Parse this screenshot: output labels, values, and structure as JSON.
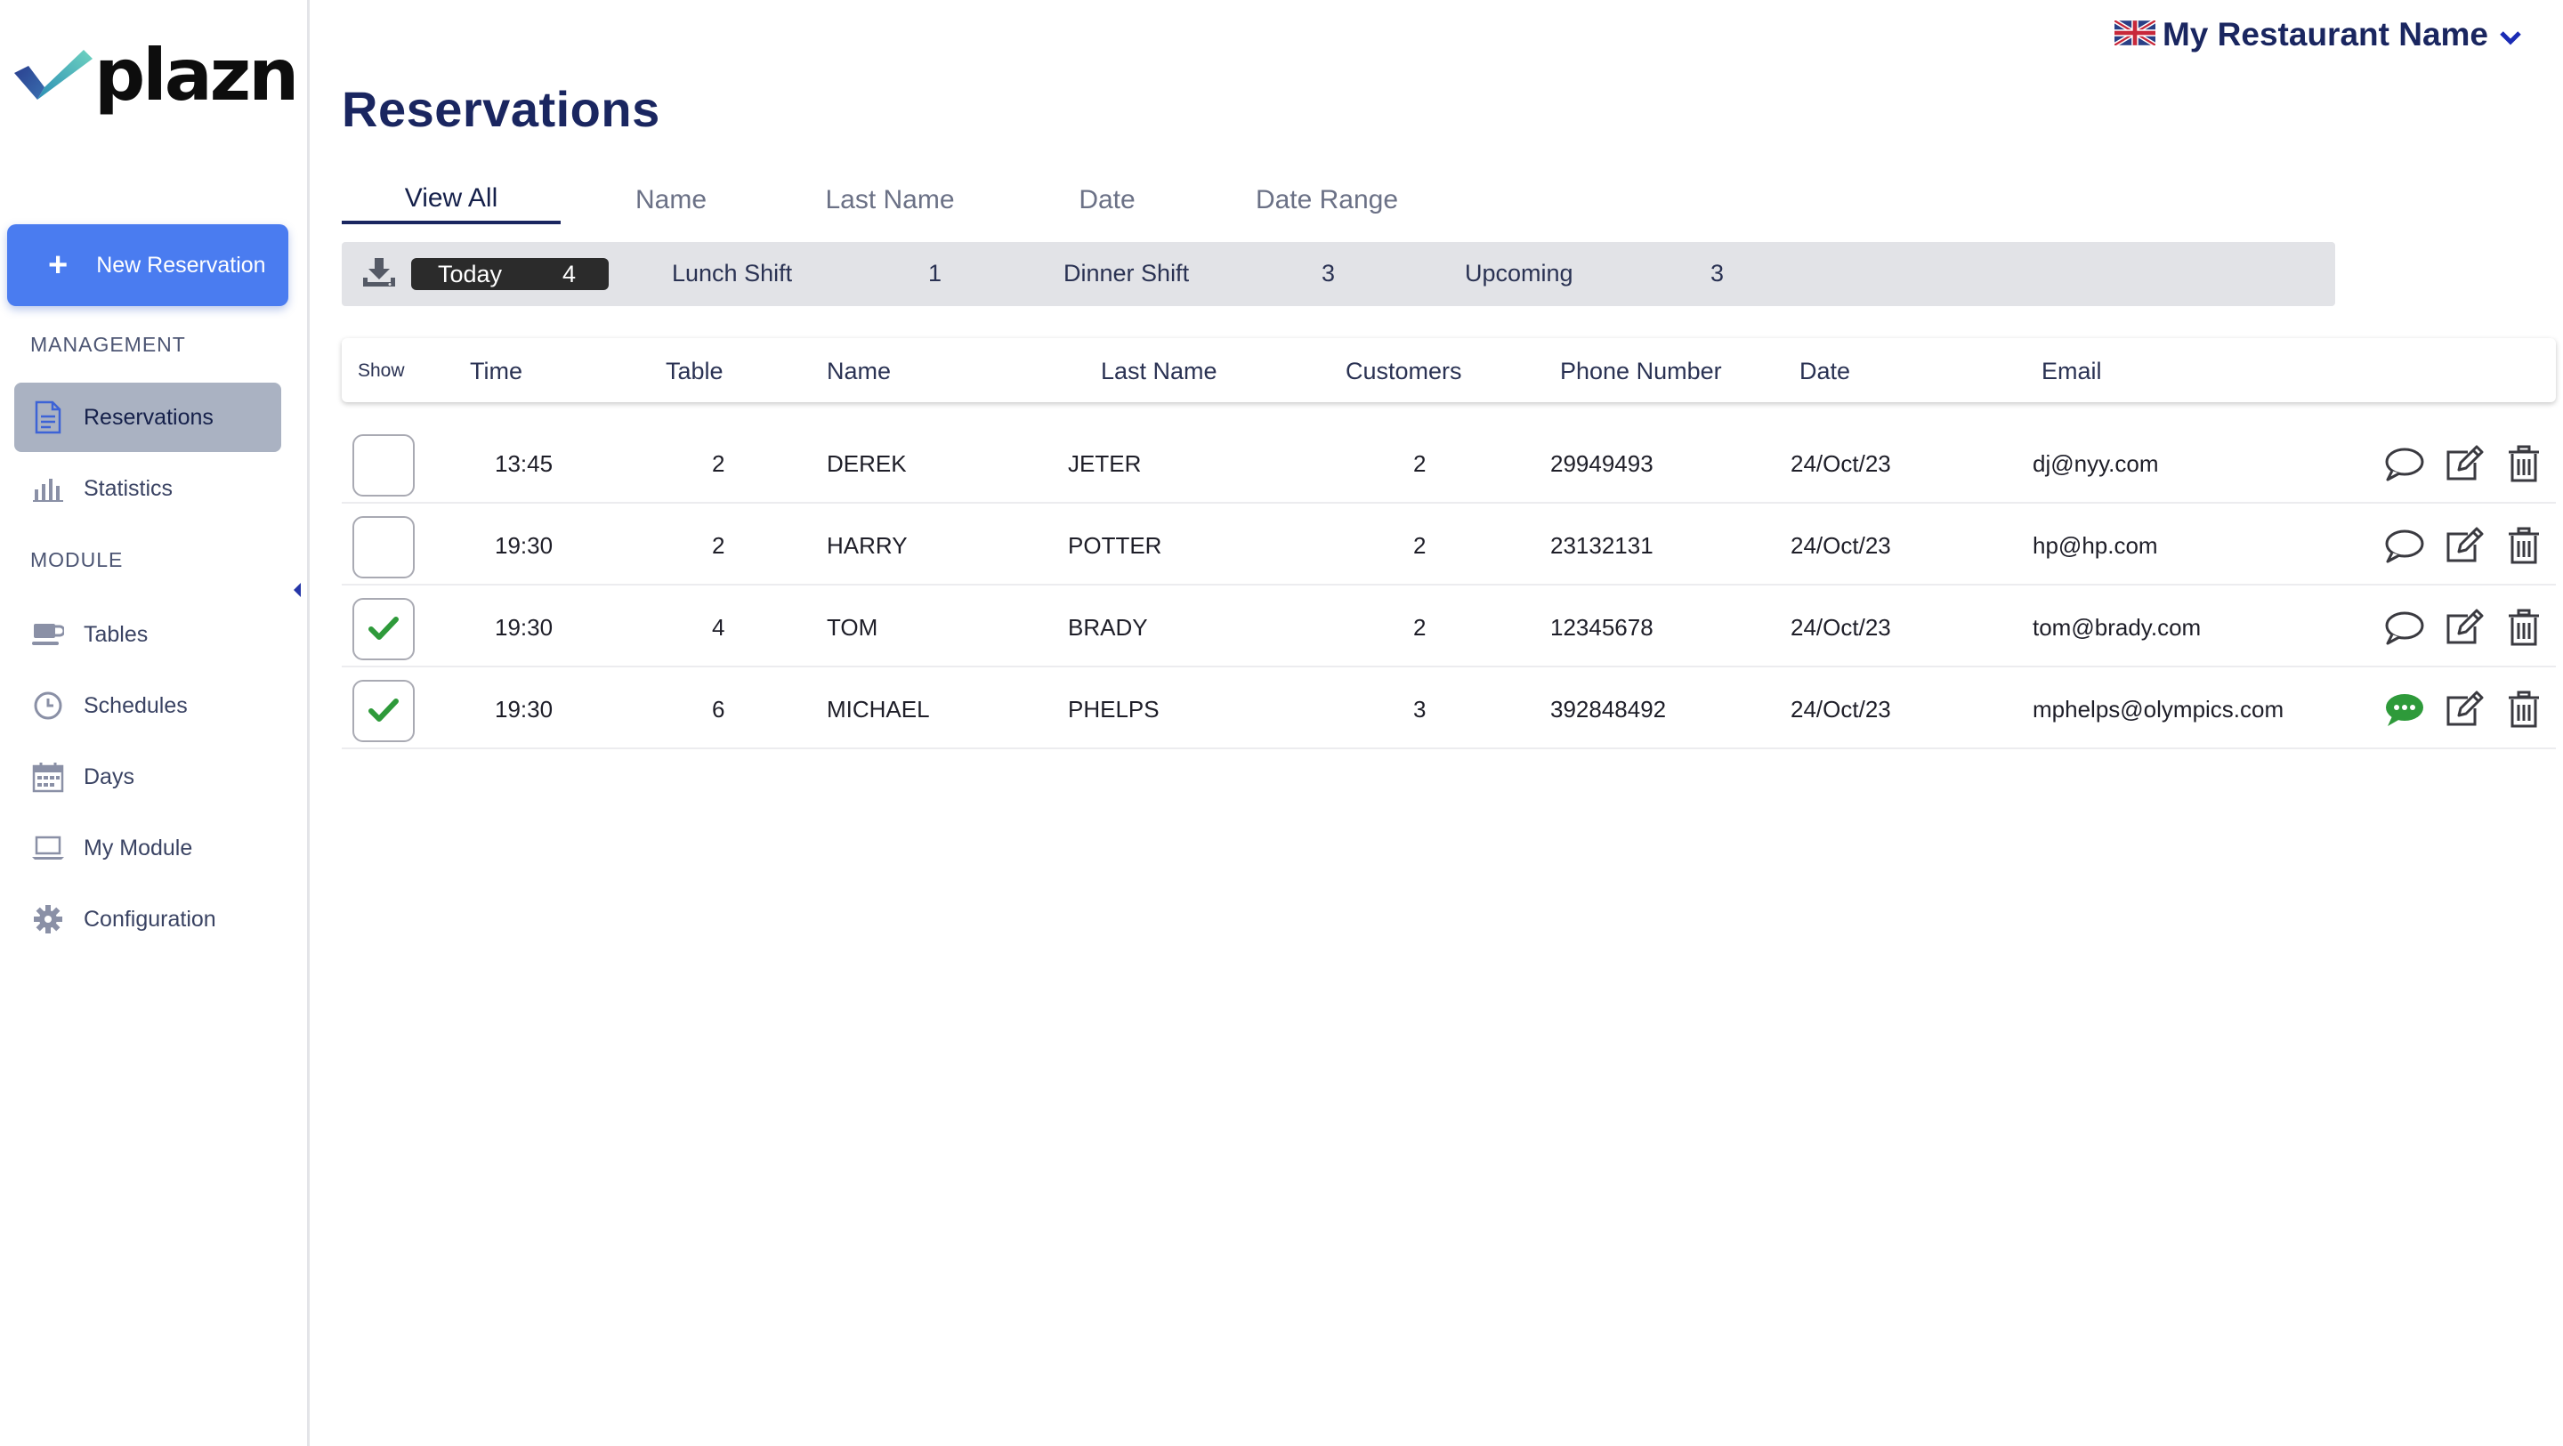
{
  "app": {
    "logo_text": "plazn",
    "restaurant_name": "My Restaurant Name"
  },
  "sidebar": {
    "new_reservation_label": "New Reservation",
    "management_title": "MANAGEMENT",
    "module_title": "MODULE",
    "items": [
      {
        "label": "Reservations",
        "icon": "document-icon"
      },
      {
        "label": "Statistics",
        "icon": "bar-chart-icon"
      },
      {
        "label": "Tables",
        "icon": "cup-icon"
      },
      {
        "label": "Schedules",
        "icon": "clock-icon"
      },
      {
        "label": "Days",
        "icon": "calendar-icon"
      },
      {
        "label": "My Module",
        "icon": "laptop-icon"
      },
      {
        "label": "Configuration",
        "icon": "gear-icon"
      }
    ]
  },
  "page": {
    "title": "Reservations"
  },
  "tabs": [
    "View All",
    "Name",
    "Last Name",
    "Date",
    "Date Range"
  ],
  "summary": {
    "today_label": "Today",
    "today_count": "4",
    "lunch_label": "Lunch Shift",
    "lunch_count": "1",
    "dinner_label": "Dinner Shift",
    "dinner_count": "3",
    "upcoming_label": "Upcoming",
    "upcoming_count": "3"
  },
  "table": {
    "headers": {
      "show": "Show",
      "time": "Time",
      "table": "Table",
      "name": "Name",
      "last_name": "Last Name",
      "customers": "Customers",
      "phone": "Phone Number",
      "date": "Date",
      "email": "Email"
    },
    "rows": [
      {
        "checked": false,
        "time": "13:45",
        "table": "2",
        "name": "DEREK",
        "last_name": "JETER",
        "customers": "2",
        "phone": "29949493",
        "date": "24/Oct/23",
        "email": "dj@nyy.com",
        "has_comment": false
      },
      {
        "checked": false,
        "time": "19:30",
        "table": "2",
        "name": "HARRY",
        "last_name": "POTTER",
        "customers": "2",
        "phone": "23132131",
        "date": "24/Oct/23",
        "email": "hp@hp.com",
        "has_comment": false
      },
      {
        "checked": true,
        "time": "19:30",
        "table": "4",
        "name": "TOM",
        "last_name": "BRADY",
        "customers": "2",
        "phone": "12345678",
        "date": "24/Oct/23",
        "email": "tom@brady.com",
        "has_comment": false
      },
      {
        "checked": true,
        "time": "19:30",
        "table": "6",
        "name": "MICHAEL",
        "last_name": "PHELPS",
        "customers": "3",
        "phone": "392848492",
        "date": "24/Oct/23",
        "email": "mphelps@olympics.com",
        "has_comment": true
      }
    ]
  },
  "colors": {
    "brand_blue": "#4a7cf0",
    "navy": "#1a2660",
    "check_green": "#2e9a3a",
    "comment_green": "#2e9a3a"
  }
}
